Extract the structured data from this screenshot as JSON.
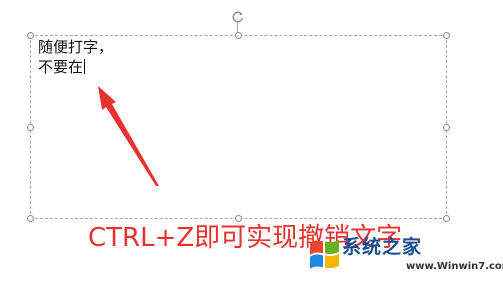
{
  "textbox": {
    "line1": "随便打字，",
    "line2": "不要在"
  },
  "instruction": {
    "text": "CTRL+Z即可实现撤销文字",
    "color": "#e8322f"
  },
  "watermark": {
    "title": "系统之家",
    "url": "www.Winwin7.com",
    "logo_icon": "windows7-logo-icon"
  },
  "colors": {
    "arrow": "#e8322f",
    "frame_border": "#a9a9a9",
    "watermark_blue": "#1a4d8f"
  }
}
